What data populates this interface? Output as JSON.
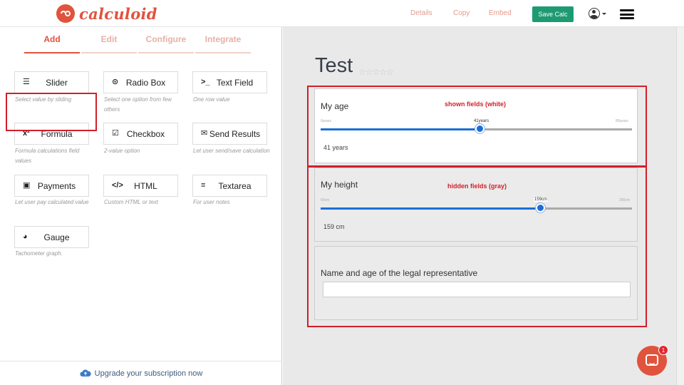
{
  "brand": {
    "name": "calculoid",
    "color": "#e0533d"
  },
  "header": {
    "links": [
      "Details",
      "Copy",
      "Embed"
    ],
    "save_label": "Save Calc",
    "user_icon": "user-icon",
    "menu_icon": "hamburger-icon"
  },
  "left_tabs": [
    {
      "label": "Add",
      "active": true
    },
    {
      "label": "Edit",
      "active": false
    },
    {
      "label": "Configure",
      "active": false
    },
    {
      "label": "Integrate",
      "active": false
    }
  ],
  "field_types": [
    {
      "label": "Slider",
      "desc": "Select value by sliding",
      "icon": "sliders-icon"
    },
    {
      "label": "Radio Box",
      "desc": "Select one option from few others",
      "icon": "radio-icon"
    },
    {
      "label": "Text Field",
      "desc": "One row value",
      "icon": "terminal-icon"
    },
    {
      "label": "Formula",
      "desc": "Formula calculations field values",
      "icon": "superscript-icon"
    },
    {
      "label": "Checkbox",
      "desc": "2-value option",
      "icon": "checkbox-icon"
    },
    {
      "label": "Send Results",
      "desc": "Let user send/save calculation",
      "icon": "envelope-icon"
    },
    {
      "label": "Payments",
      "desc": "Let user pay calculated value",
      "icon": "money-icon"
    },
    {
      "label": "HTML",
      "desc": "Custom HTML or text",
      "icon": "code-icon"
    },
    {
      "label": "Textarea",
      "desc": "For user notes",
      "icon": "align-left-icon"
    },
    {
      "label": "Gauge",
      "desc": "Tachometer graph.",
      "icon": "gauge-icon"
    }
  ],
  "upgrade_label": "Upgrade your subscription now",
  "form": {
    "title": "Test",
    "stars": "☆☆☆☆☆",
    "age": {
      "label": "My age",
      "min_label": "0years",
      "max_label": "80years",
      "tooltip": "41years",
      "min": 0,
      "max": 80,
      "value": 41,
      "value_display": "41  years",
      "annotation": "shown fields (white)"
    },
    "height": {
      "label": "My height",
      "min_label": "60cm",
      "max_label": "200cm",
      "tooltip": "159cm",
      "min": 60,
      "max": 200,
      "value": 159,
      "value_display": "159  cm",
      "annotation": "hidden fields (gray)"
    },
    "representative": {
      "label": "Name and age of the legal representative",
      "value": ""
    }
  },
  "chat_badge": "1",
  "colors": {
    "accent": "#e0533d",
    "save": "#1e9a72",
    "slider": "#1a6fd6",
    "annotation": "#d11f2a"
  }
}
